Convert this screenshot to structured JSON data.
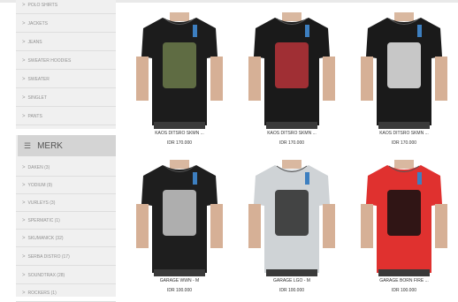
{
  "categories": [
    {
      "label": "POLO SHIRTS"
    },
    {
      "label": "JACKETS"
    },
    {
      "label": "JEANS"
    },
    {
      "label": "SWEATER HOODIES"
    },
    {
      "label": "SWEATER"
    },
    {
      "label": "SINGLET"
    },
    {
      "label": "PANTS"
    }
  ],
  "merk": {
    "title": "MERK",
    "items": [
      {
        "label": "DAKEN (3)"
      },
      {
        "label": "YODIUM (9)"
      },
      {
        "label": "VURLEYS (3)"
      },
      {
        "label": "SPERMATIC (1)"
      },
      {
        "label": "SKUMANICK (32)"
      },
      {
        "label": "SERBA DISTRO (17)"
      },
      {
        "label": "SOUNDTRAX (28)"
      },
      {
        "label": "ROCKERS (1)"
      }
    ]
  },
  "products": [
    {
      "name": "KAOS DITSRO SKMN ...",
      "price": "IDR 170.000",
      "shirt_color": "#1c1c1c",
      "print_color": "#6b7a4a"
    },
    {
      "name": "KAOS DITSRO SKMN ...",
      "price": "IDR 170.000",
      "shirt_color": "#1a1a1a",
      "print_color": "#b9343a"
    },
    {
      "name": "KAOS DITSRO SKMN ...",
      "price": "IDR 170.000",
      "shirt_color": "#1a1a1a",
      "print_color": "#e6e6e6"
    },
    {
      "name": "GARAGE WWN - M",
      "price": "IDR 100.000",
      "shirt_color": "#1e1e1e",
      "print_color": "#c8c8c8"
    },
    {
      "name": "GARAGE LGO - M",
      "price": "IDR 100.000",
      "shirt_color": "#cfd3d6",
      "print_color": "#2a2a2a"
    },
    {
      "name": "GARAGE BORN FIRE ...",
      "price": "IDR 100.000",
      "shirt_color": "#e0312f",
      "print_color": "#111111"
    }
  ]
}
